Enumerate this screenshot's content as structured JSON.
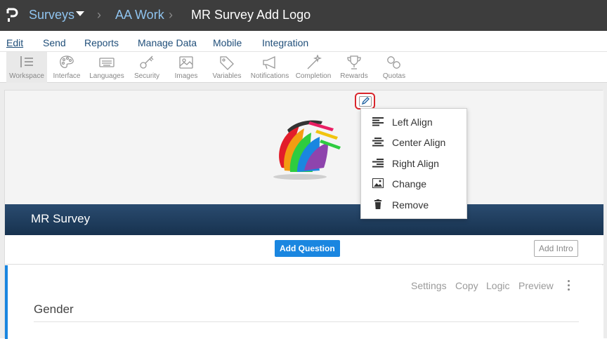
{
  "header": {
    "crumbs": [
      "Surveys",
      "AA Work"
    ],
    "separator": "›",
    "title": "MR Survey Add Logo"
  },
  "menu": [
    "Edit",
    "Send",
    "Reports",
    "Manage Data",
    "Mobile",
    "Integration"
  ],
  "toolbar": [
    {
      "label": "Workspace",
      "icon": "workspace-icon",
      "active": true
    },
    {
      "label": "Interface",
      "icon": "palette-icon"
    },
    {
      "label": "Languages",
      "icon": "keyboard-icon"
    },
    {
      "label": "Security",
      "icon": "key-icon"
    },
    {
      "label": "Images",
      "icon": "image-icon"
    },
    {
      "label": "Variables",
      "icon": "tag-icon"
    },
    {
      "label": "Notifications",
      "icon": "megaphone-icon"
    },
    {
      "label": "Completion",
      "icon": "magic-wand-icon"
    },
    {
      "label": "Rewards",
      "icon": "trophy-icon"
    },
    {
      "label": "Quotas",
      "icon": "link-icon"
    }
  ],
  "survey": {
    "title": "MR Survey",
    "add_question": "Add Question",
    "add_intro": "Add Intro"
  },
  "question": {
    "tools": [
      "Settings",
      "Copy",
      "Logic",
      "Preview"
    ],
    "title": "Gender"
  },
  "logo_menu": [
    "Left Align",
    "Center Align",
    "Right Align",
    "Change",
    "Remove"
  ],
  "colors": {
    "topbar": "#3d3d3d",
    "accent": "#1a86e0",
    "band": "#1f3d5e",
    "highlight": "#d9262c"
  }
}
